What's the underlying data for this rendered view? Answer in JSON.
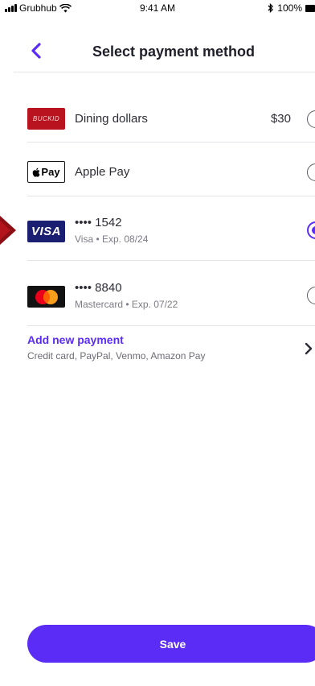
{
  "status_bar": {
    "carrier": "Grubhub",
    "time": "9:41 AM",
    "battery": "100%"
  },
  "header": {
    "title": "Select payment method"
  },
  "payments": [
    {
      "logo_text": "BUCKID",
      "label": "Dining dollars",
      "amount": "$30",
      "selected": false
    },
    {
      "logo_text": "Pay",
      "label": "Apple Pay",
      "selected": false
    },
    {
      "logo_text": "VISA",
      "label": "•••• 1542",
      "sub": "Visa • Exp. 08/24",
      "selected": true
    },
    {
      "label": "•••• 8840",
      "sub": "Mastercard • Exp. 07/22",
      "selected": false
    }
  ],
  "add_payment": {
    "title": "Add new payment",
    "subtitle": "Credit card, PayPal, Venmo, Amazon Pay"
  },
  "save_button": {
    "label": "Save"
  },
  "colors": {
    "accent": "#5a2cf5",
    "marker": "#8b0f14",
    "visa": "#1a1f71",
    "buckid": "#b8131e"
  }
}
